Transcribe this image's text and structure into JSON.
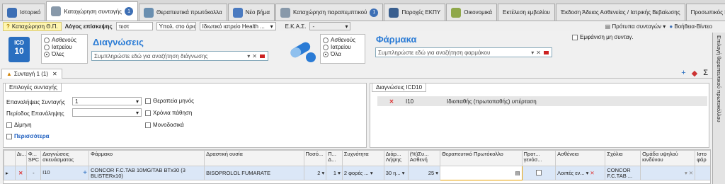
{
  "tabs": [
    {
      "label": "Ιστορικό",
      "icon": "history-icon",
      "color": "#3d6fb5"
    },
    {
      "label": "Καταχώρηση συνταγής",
      "icon": "document-icon",
      "color": "#8899aa",
      "badge": "1",
      "active": true
    },
    {
      "label": "Θεραπευτικά πρωτόκολλα",
      "icon": "protocol-icon",
      "color": "#6a8fb0"
    },
    {
      "label": "Νέο βήμα",
      "icon": "new-step-icon",
      "color": "#4a7ac0"
    },
    {
      "label": "Καταχώρηση παραπεμπτικού",
      "icon": "referral-icon",
      "color": "#8899aa",
      "badge": "1"
    },
    {
      "label": "Παροχές ΕΚΠΥ",
      "icon": "eye-icon",
      "color": "#3a5f8f"
    },
    {
      "label": "Οικονομικά",
      "icon": "money-icon",
      "color": "#8fa84a"
    },
    {
      "label": "Εκτέλεση εμβολίου"
    },
    {
      "label": "Έκδοση Άδειας Ασθενείας / Ιατρικής Βεβαίωσης"
    },
    {
      "label": "Προσωπικός Ιατρός"
    }
  ],
  "toolbar": {
    "kataxorisi": "Καταχώρηση Θ.Π.",
    "logos_label": "Λόγος επίσκεψης",
    "logos_value": "τεστ",
    "ypol": "Υπολ. στο όριο",
    "iatreio": "Ιδιωτικό ιατρείο Health ...",
    "ekas_label": "Ε.Κ.Α.Σ.",
    "ekas_value": "-",
    "protypa": "Πρότυπα συνταγών",
    "help": "Βοήθεια-Βίντεο"
  },
  "diagnoses": {
    "title": "Διαγνώσεις",
    "placeholder": "Συμπληρώστε εδώ για αναζήτηση διάγνωσης",
    "radios": [
      "Ασθενούς",
      "Ιατρείου",
      "Όλες"
    ],
    "selected": 2,
    "icd_top": "ICD",
    "icd_bottom": "10"
  },
  "drugs": {
    "title": "Φάρμακα",
    "placeholder": "Συμπληρώστε εδώ για αναζήτηση φαρμάκου",
    "radios": [
      "Ασθενούς",
      "Ιατρείου",
      "Όλα"
    ],
    "selected": 2,
    "show_label": "Εμφάνιση μη συνταγ."
  },
  "side_tab": "Επιλογή θεραπευτικού πρωτοκόλλου",
  "script_tab": "Συνταγή 1 (1)",
  "options": {
    "header": "Επιλογές συνταγής",
    "repeat_label": "Επαναλήψεις Συνταγής",
    "repeat_value": "1",
    "period_label": "Περίοδος Επανάληψης",
    "period_value": "",
    "dimini": "Δίμηνη",
    "more": "Περισσότερα",
    "therapeia": "Θεραπεία μηνός",
    "chronia": "Χρόνια πάθηση",
    "monodosika": "Μονοδοσικά"
  },
  "icd_panel": {
    "header": "Διαγνώσεις ICD10",
    "rows": [
      {
        "code": "I10",
        "desc": "Ιδιοπαθής (πρωτοπαθής) υπέρταση"
      }
    ]
  },
  "grid": {
    "headers": [
      "Δι...",
      "Φ... SPC",
      "Διαγνώσεις σκευάσματος",
      "Φάρμακο",
      "Δραστική ουσία",
      "Ποσό...",
      "Π... Δ...",
      "Συχνότητα",
      "Διάρ... Λήψης",
      "(%)Συ... Ασθενή",
      "Θεραπευτικό Πρωτόκολλο",
      "Προτ... γενόσ...",
      "Ασθένεια",
      "Σχόλια",
      "Ομάδα υψηλού κινδύνου",
      "Ιστο φάρ"
    ],
    "row": {
      "diag": "I10",
      "drug": "CONCOR F.C.TAB 10MG/TAB BTx30 (3 BLISTERx10)",
      "substance": "BISOPROLOL FUMARATE",
      "qty": "2",
      "p": "1",
      "freq": "2 φορές ...",
      "dur": "30 η...",
      "pct": "25",
      "disease": "Λοιπές εν...",
      "comment": "CONCOR F.C.TAB ..."
    }
  }
}
